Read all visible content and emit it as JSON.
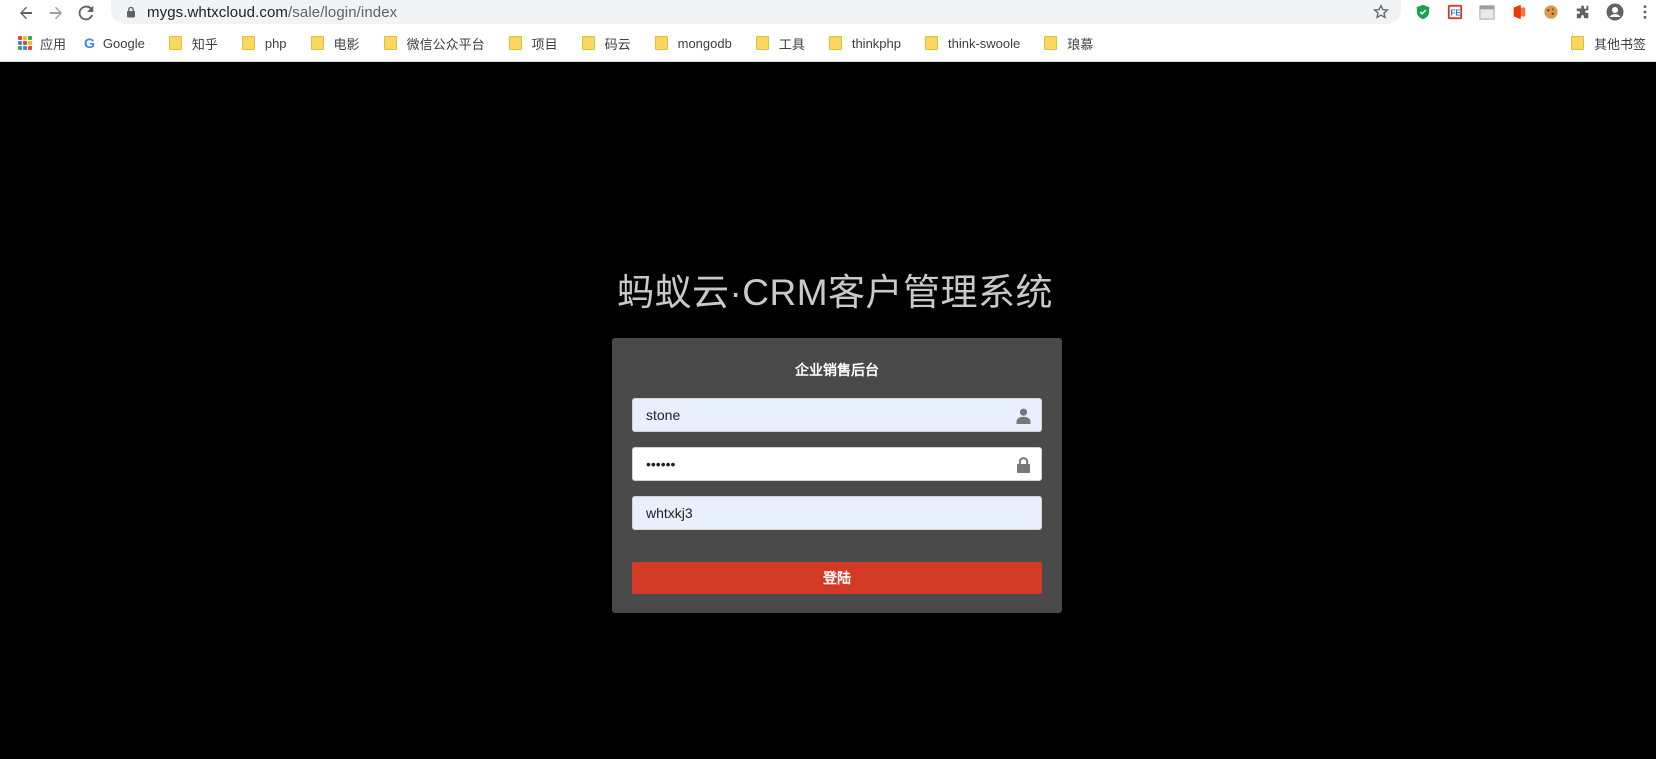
{
  "browser": {
    "url_host": "mygs.whtxcloud.com",
    "url_path": "/sale/login/index"
  },
  "bookmarks": {
    "items": [
      {
        "label": "应用",
        "icon": "apps-grid-icon"
      },
      {
        "label": "Google",
        "icon": "google-icon"
      },
      {
        "label": "知乎",
        "icon": "folder-icon"
      },
      {
        "label": "php",
        "icon": "folder-icon"
      },
      {
        "label": "电影",
        "icon": "folder-icon"
      },
      {
        "label": "微信公众平台",
        "icon": "folder-icon"
      },
      {
        "label": "项目",
        "icon": "folder-icon"
      },
      {
        "label": "码云",
        "icon": "folder-icon"
      },
      {
        "label": "mongodb",
        "icon": "folder-icon"
      },
      {
        "label": "工具",
        "icon": "folder-icon"
      },
      {
        "label": "thinkphp",
        "icon": "folder-icon"
      },
      {
        "label": "think-swoole",
        "icon": "folder-icon"
      },
      {
        "label": "琅慕",
        "icon": "folder-icon"
      }
    ],
    "other": "其他书签"
  },
  "page": {
    "title": "蚂蚁云·CRM客户管理系统",
    "box_title": "企业销售后台",
    "username": {
      "value": "stone"
    },
    "password": {
      "value": "••••••"
    },
    "company": {
      "value": "whtxkj3"
    },
    "login_label": "登陆"
  },
  "colors": {
    "background": "#000000",
    "panel": "#4a4a4a",
    "button": "#d33a25",
    "autofill": "#e8f0fe"
  }
}
